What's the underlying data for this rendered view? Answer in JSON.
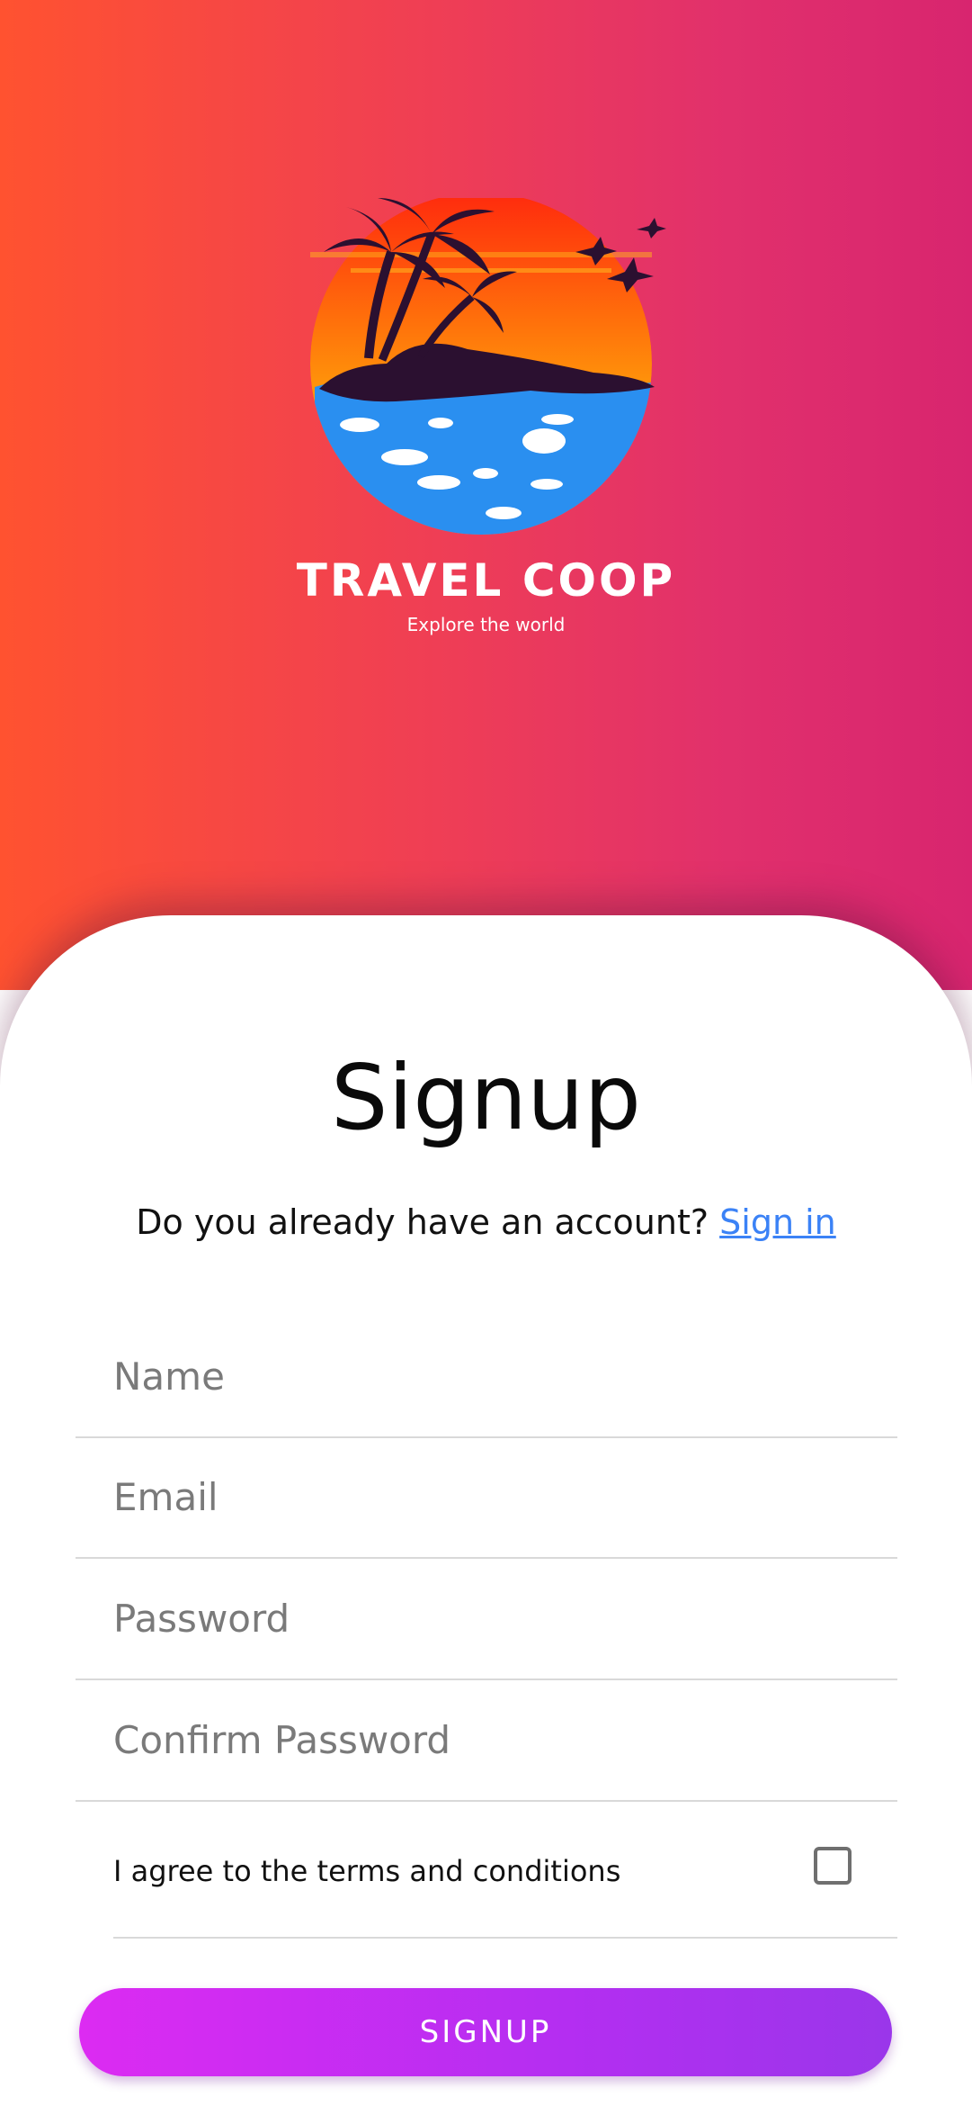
{
  "brand": {
    "name": "TRAVEL COOP",
    "tagline": "Explore the world"
  },
  "form": {
    "title": "Signup",
    "account_prompt": "Do you already have an account?",
    "signin_link": "Sign in",
    "fields": {
      "name_placeholder": "Name",
      "email_placeholder": "Email",
      "password_placeholder": "Password",
      "confirm_password_placeholder": "Confirm Password"
    },
    "terms_label": "I agree to the terms and conditions",
    "terms_checked": false,
    "submit_label": "SIGNUP"
  },
  "colors": {
    "gradient_start": "#ff5230",
    "gradient_end": "#d8256f",
    "link": "#3b82f6",
    "button_start": "#dc2bf2",
    "button_end": "#9a36ea"
  }
}
